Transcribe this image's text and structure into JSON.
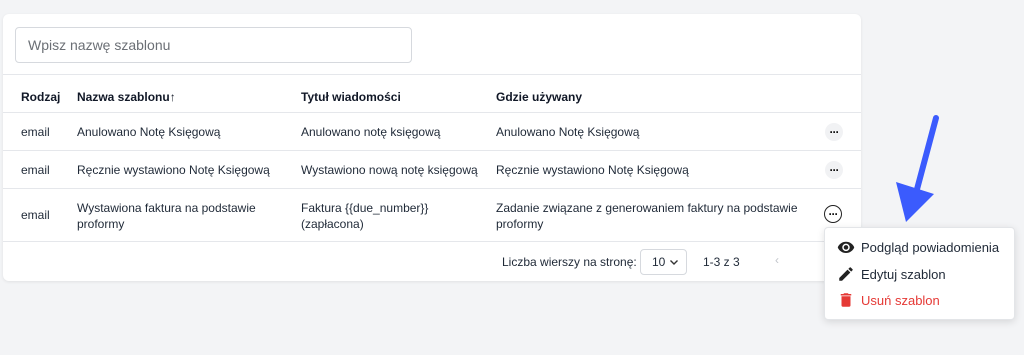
{
  "search": {
    "placeholder": "Wpisz nazwę szablonu"
  },
  "table": {
    "columns": {
      "type": "Rodzaj",
      "name": "Nazwa szablonu",
      "sort_indicator": "↑",
      "title": "Tytuł wiadomości",
      "used": "Gdzie używany"
    },
    "rows": [
      {
        "type": "email",
        "name": "Anulowano Notę Księgową",
        "title": "Anulowano notę księgową",
        "used": "Anulowano Notę Księgową"
      },
      {
        "type": "email",
        "name": "Ręcznie wystawiono Notę Księgową",
        "title": "Wystawiono nową notę księgową",
        "used": "Ręcznie wystawiono Notę Księgową"
      },
      {
        "type": "email",
        "name_line1": "Wystawiona faktura na podstawie",
        "name_line2": "proformy",
        "title_line1": "Faktura {{due_number}}",
        "title_line2": "(zapłacona)",
        "used_line1": "Zadanie związane z generowaniem faktury na podstawie",
        "used_line2": "proformy"
      }
    ],
    "actions_label": "···"
  },
  "footer": {
    "rows_per_page_label": "Liczba wierszy na stronę:",
    "rows_per_page_value": "10",
    "range": "1-3 z 3",
    "prev": "‹"
  },
  "context_menu": {
    "preview": "Podgląd powiadomienia",
    "edit": "Edytuj szablon",
    "delete": "Usuń szablon"
  },
  "colors": {
    "arrow": "#3b5bfd",
    "danger": "#e53935"
  },
  "icons": [
    "eye-icon",
    "pencil-icon",
    "trash-icon",
    "chevron-down-icon",
    "more-dots-icon",
    "arrow-down-icon"
  ]
}
